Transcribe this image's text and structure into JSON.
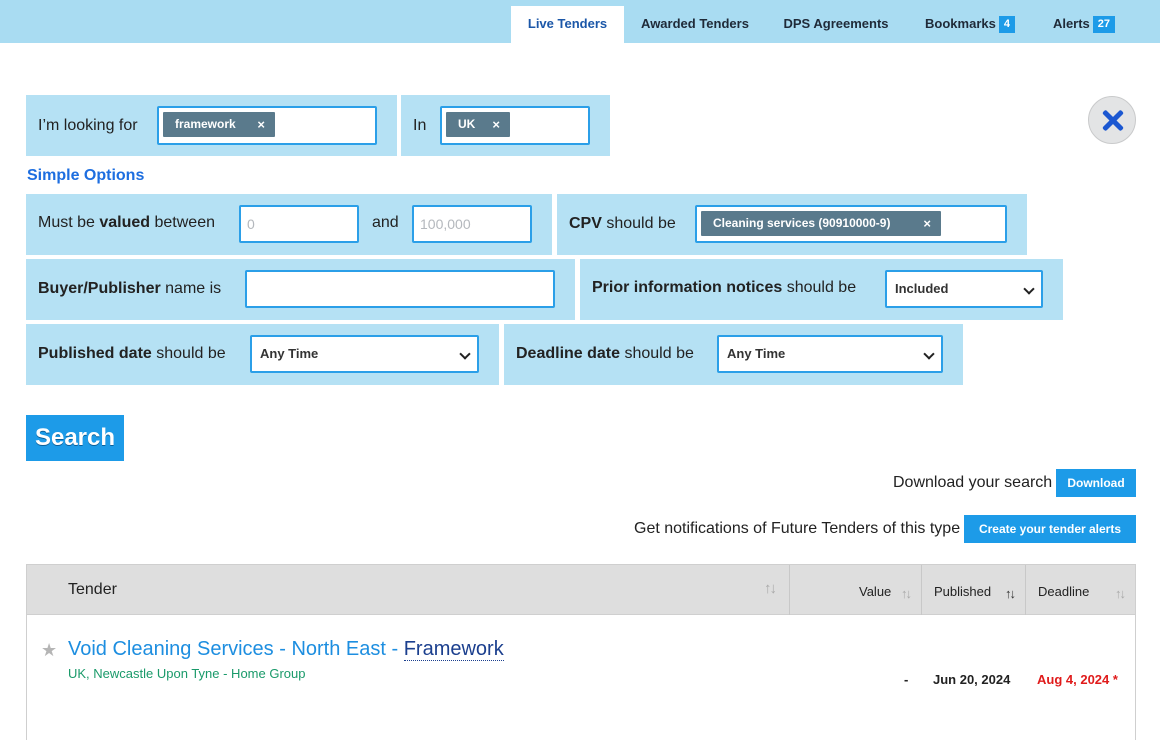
{
  "tabs": [
    {
      "label": "Live Tenders"
    },
    {
      "label": "Awarded Tenders"
    },
    {
      "label": "DPS Agreements"
    },
    {
      "label": "Bookmarks",
      "count": "4"
    },
    {
      "label": "Alerts",
      "count": "27"
    }
  ],
  "search_bar": {
    "looking_for_label": "I’m looking for",
    "keyword_chip": "framework",
    "in_label": "In",
    "location_chip": "UK",
    "chip_remove": "×"
  },
  "simple_options_label": "Simple Options",
  "filters": {
    "value": {
      "prefix": "Must be ",
      "bold": "valued",
      "suffix": " between",
      "and_label": "and",
      "min_placeholder": "0",
      "max_placeholder": "100,000"
    },
    "cpv": {
      "bold": "CPV",
      "suffix": " should be",
      "chip": "Cleaning services (90910000-9)"
    },
    "buyer": {
      "bold": "Buyer/Publisher",
      "suffix": " name is"
    },
    "prior": {
      "bold": "Prior information notices",
      "suffix": " should be",
      "selected": "Included"
    },
    "published": {
      "bold": "Published date",
      "suffix": " should be",
      "selected": "Any Time"
    },
    "deadline": {
      "bold": "Deadline date",
      "suffix": " should be",
      "selected": "Any Time"
    }
  },
  "search_button": "Search",
  "download": {
    "text": "Download your search",
    "button": "Download"
  },
  "alerts_cta": {
    "text": "Get notifications of Future Tenders of this type",
    "button": "Create your tender alerts"
  },
  "table": {
    "columns": [
      "Tender",
      "Value",
      "Published",
      "Deadline"
    ],
    "sort_glyph": "↑↓",
    "rows": [
      {
        "title_main": "Void Cleaning Services - North East - ",
        "title_tag": "Framework",
        "subtitle": "UK, Newcastle Upon Tyne - Home Group",
        "value": "-",
        "published": "Jun 20, 2024",
        "deadline": "Aug 4, 2024 *"
      }
    ]
  },
  "colors": {
    "accent": "#1d9be8",
    "panel": "#b5e1f4",
    "topbar": "#a9dcf2",
    "deadline_red": "#e01b1b"
  },
  "icons": {
    "close": "close-icon",
    "star": "star-icon",
    "sort": "sort-icon",
    "chevron": "chevron-down-icon"
  }
}
